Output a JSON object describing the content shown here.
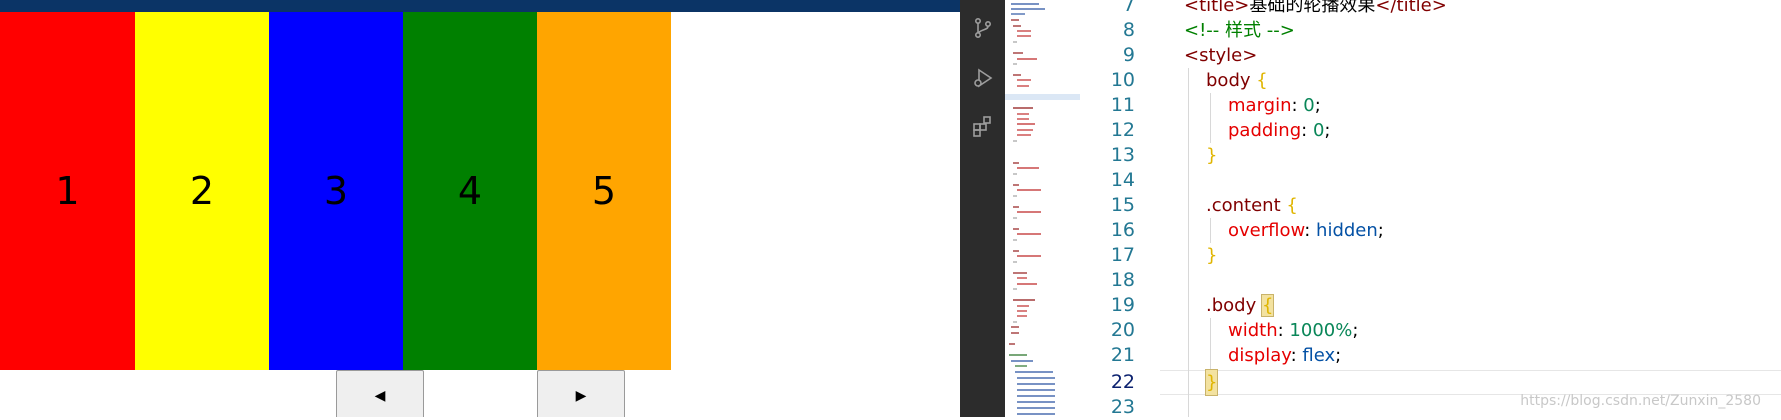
{
  "preview": {
    "slides": [
      {
        "label": "1",
        "color": "#ff0000"
      },
      {
        "label": "2",
        "color": "#ffff00"
      },
      {
        "label": "3",
        "color": "#0000ff"
      },
      {
        "label": "4",
        "color": "#008000"
      },
      {
        "label": "5",
        "color": "#ffa500"
      }
    ],
    "prev_label": "◀",
    "next_label": "▶"
  },
  "activity_bar": {
    "icons": [
      "source-control-icon",
      "run-debug-icon",
      "extensions-icon"
    ]
  },
  "gutter": {
    "line_numbers": [
      "7",
      "8",
      "9",
      "10",
      "11",
      "12",
      "13",
      "14",
      "15",
      "16",
      "17",
      "18",
      "19",
      "20",
      "21",
      "22",
      "23"
    ],
    "current_line": "22"
  },
  "code": {
    "l7": {
      "open": "<title>",
      "text": "基础的轮播效果",
      "close": "</title>"
    },
    "l8": "<!-- 样式 -->",
    "l9": "<style>",
    "l10": {
      "sel": "body",
      "brace": "{"
    },
    "l11": {
      "prop": "margin",
      "val": "0"
    },
    "l12": {
      "prop": "padding",
      "val": "0"
    },
    "l13": "}",
    "l15": {
      "sel": ".content",
      "brace": "{"
    },
    "l16": {
      "prop": "overflow",
      "val": "hidden"
    },
    "l17": "}",
    "l19": {
      "sel": ".body",
      "brace": "{"
    },
    "l20": {
      "prop": "width",
      "val": "1000%"
    },
    "l21": {
      "prop": "display",
      "val": "flex"
    },
    "l22": "}"
  },
  "watermark": "https://blog.csdn.net/Zunxin_2580"
}
